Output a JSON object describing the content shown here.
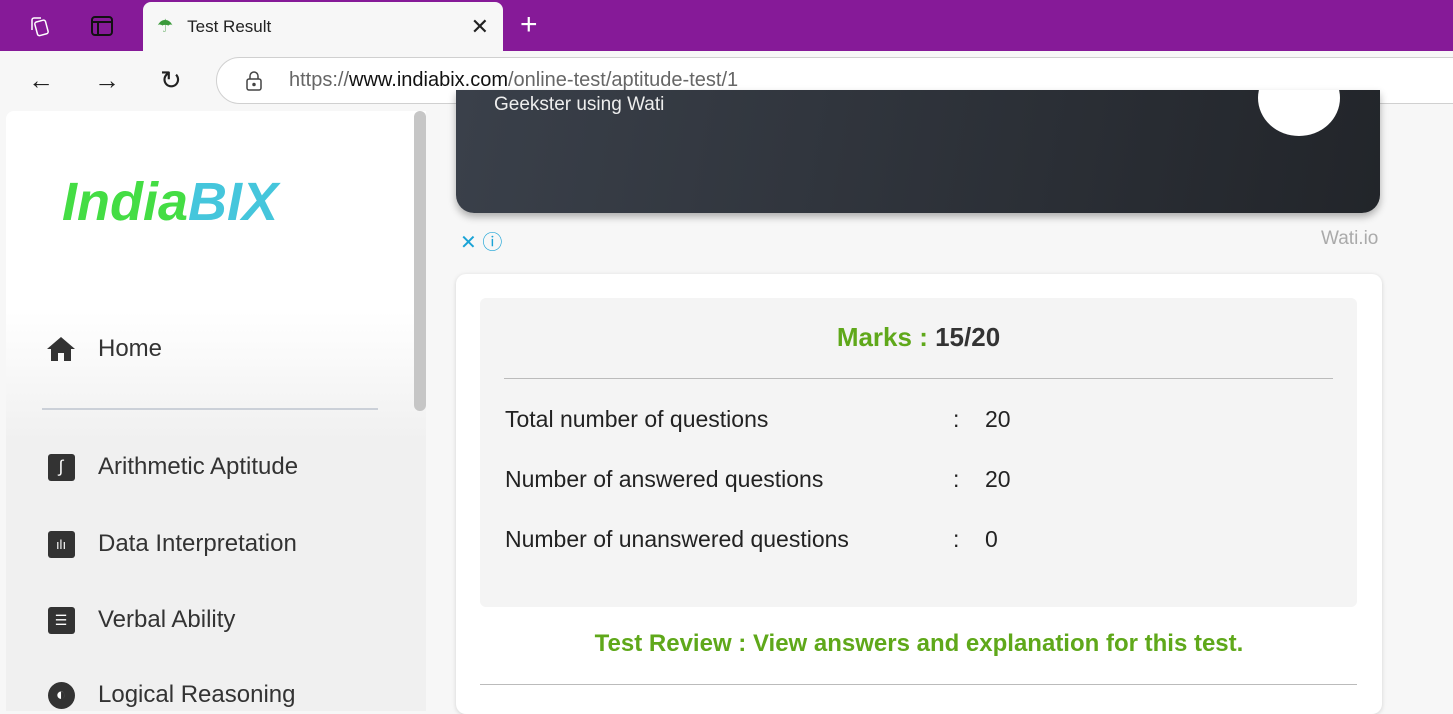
{
  "browser": {
    "tab_title": "Test Result",
    "url_prefix": "https://",
    "url_host": "www.indiabix.com",
    "url_path": "/online-test/aptitude-test/1"
  },
  "sidebar": {
    "logo": {
      "part1": "India",
      "part2": "BIX"
    },
    "items": [
      {
        "label": "Home"
      },
      {
        "label": "Arithmetic Aptitude"
      },
      {
        "label": "Data Interpretation"
      },
      {
        "label": "Verbal Ability"
      },
      {
        "label": "Logical Reasoning"
      }
    ]
  },
  "ad": {
    "text": "Geekster using Wati",
    "source": "Wati.io"
  },
  "result": {
    "marks_label": "Marks :",
    "marks_value": "15/20",
    "rows": [
      {
        "label": "Total number of questions",
        "sep": ":",
        "value": "20"
      },
      {
        "label": "Number of answered questions",
        "sep": ":",
        "value": "20"
      },
      {
        "label": "Number of unanswered questions",
        "sep": ":",
        "value": "0"
      }
    ],
    "review": "Test Review : View answers and explanation for this test."
  },
  "colors": {
    "tabbar": "#861a98",
    "accent_green": "#5fa81a"
  }
}
